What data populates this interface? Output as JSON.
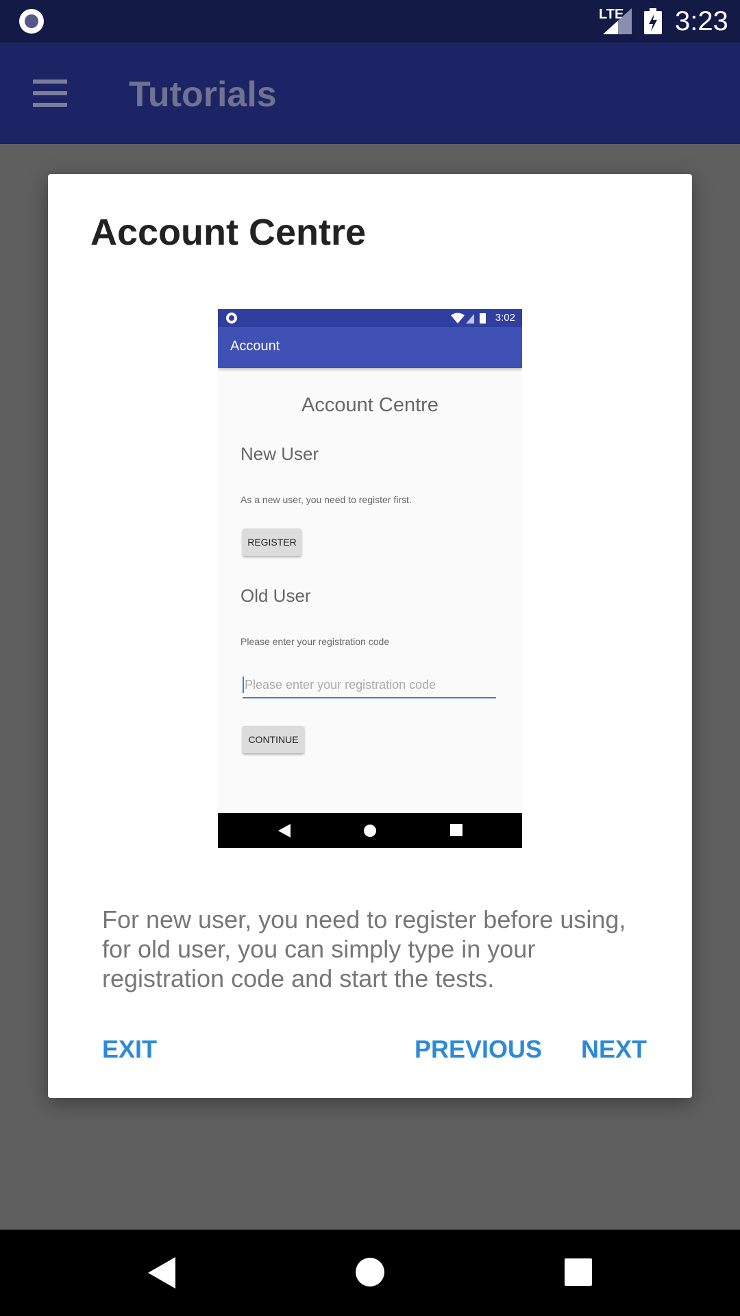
{
  "status_bar": {
    "time": "3:23",
    "network": "LTE",
    "icons": [
      "screen-record-icon",
      "signal-icon",
      "battery-charging-icon"
    ]
  },
  "app_bar": {
    "title": "Tutorials",
    "menu_icon": "hamburger-menu-icon"
  },
  "dialog": {
    "title": "Account Centre",
    "description": "For new user, you need to register before using, for old user, you can simply type in your registration code and start the tests.",
    "actions": {
      "exit": "EXIT",
      "previous": "PREVIOUS",
      "next": "NEXT"
    },
    "action_color": "#2d8ad8"
  },
  "tutorial_screenshot": {
    "status_time": "3:02",
    "app_bar_title": "Account",
    "center_title": "Account Centre",
    "new_user_heading": "New User",
    "new_user_text": "As a new user, you need to register first.",
    "register_button": "REGISTER",
    "old_user_heading": "Old User",
    "old_user_text": "Please enter your registration code",
    "code_placeholder": "Please enter your registration code",
    "continue_button": "CONTINUE",
    "accent_color": "#3f51b5"
  },
  "system_nav": {
    "icons": [
      "back-icon",
      "home-icon",
      "recents-icon"
    ]
  }
}
